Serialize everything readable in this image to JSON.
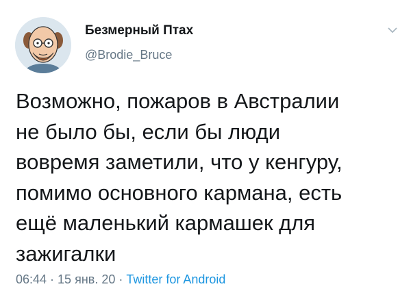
{
  "author": {
    "display_name": "Безмерный Птах",
    "handle": "@Brodie_Bruce"
  },
  "tweet": {
    "lines": [
      "Возможно, пожаров в Австралии",
      "не было бы, если бы люди",
      "вовремя заметили, что у кенгуру,",
      "помимо основного кармана, есть",
      "ещё маленький кармашек для",
      "зажигалки"
    ]
  },
  "meta": {
    "time": "06:44",
    "sep1": " · ",
    "date": "15 янв. 20",
    "sep2": " · ",
    "source": "Twitter for Android"
  },
  "icons": {
    "avatar": "cartoon-man-avatar",
    "menu": "chevron-down-icon"
  },
  "colors": {
    "text": "#14171a",
    "secondary": "#657786",
    "link": "#1b95e0"
  }
}
